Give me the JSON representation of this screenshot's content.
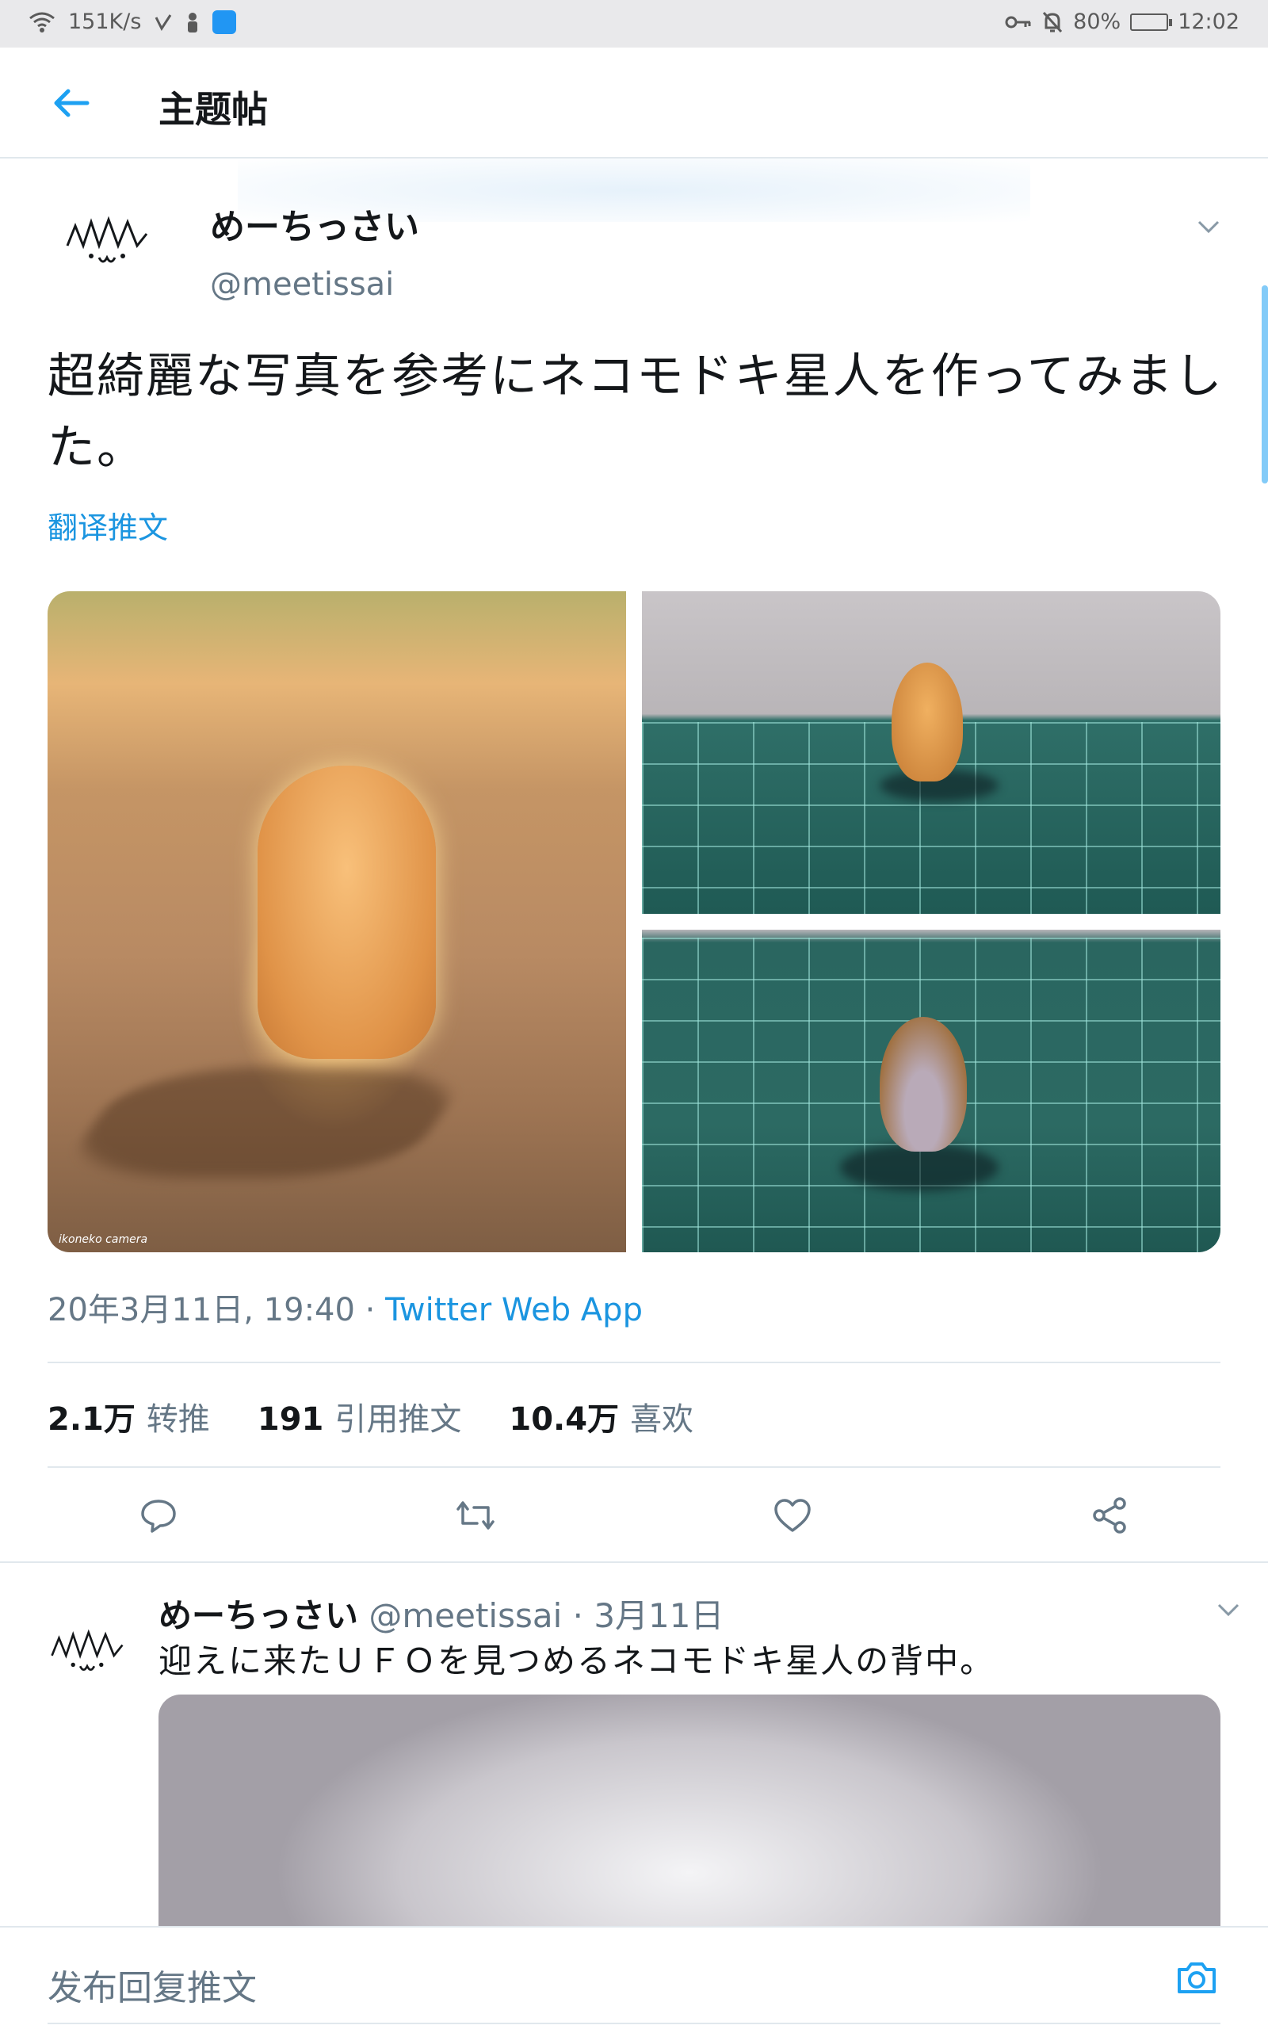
{
  "status_bar": {
    "net_speed": "151K/s",
    "battery": "80%",
    "time": "12:02"
  },
  "header": {
    "title": "主题帖"
  },
  "tweet": {
    "author_name": "めーちっさい",
    "author_handle": "@meetissai",
    "text": "超綺麗な写真を参考にネコモドキ星人を作ってみました。",
    "translate_label": "翻译推文",
    "timestamp": "20年3月11日, 19:40",
    "separator": " · ",
    "source": "Twitter Web App",
    "photo_watermark": "ikoneko camera",
    "stats": {
      "retweets_count": "2.1万",
      "retweets_label": "转推",
      "quotes_count": "191",
      "quotes_label": "引用推文",
      "likes_count": "10.4万",
      "likes_label": "喜欢"
    }
  },
  "reply": {
    "author_name": "めーちっさい",
    "meta": "@meetissai · 3月11日",
    "text": "迎えに来たＵＦＯを見つめるネコモドキ星人の背中。"
  },
  "compose": {
    "placeholder": "发布回复推文"
  },
  "icons": {
    "back": "arrow-left",
    "more": "chevron-down",
    "reply": "speech-bubble",
    "retweet": "retweet-arrows",
    "like": "heart",
    "share": "share-nodes",
    "camera": "camera"
  },
  "colors": {
    "accent": "#1DA1F2",
    "link": "#1B95E0",
    "secondary_text": "#657786",
    "divider": "#E1E8ED"
  }
}
